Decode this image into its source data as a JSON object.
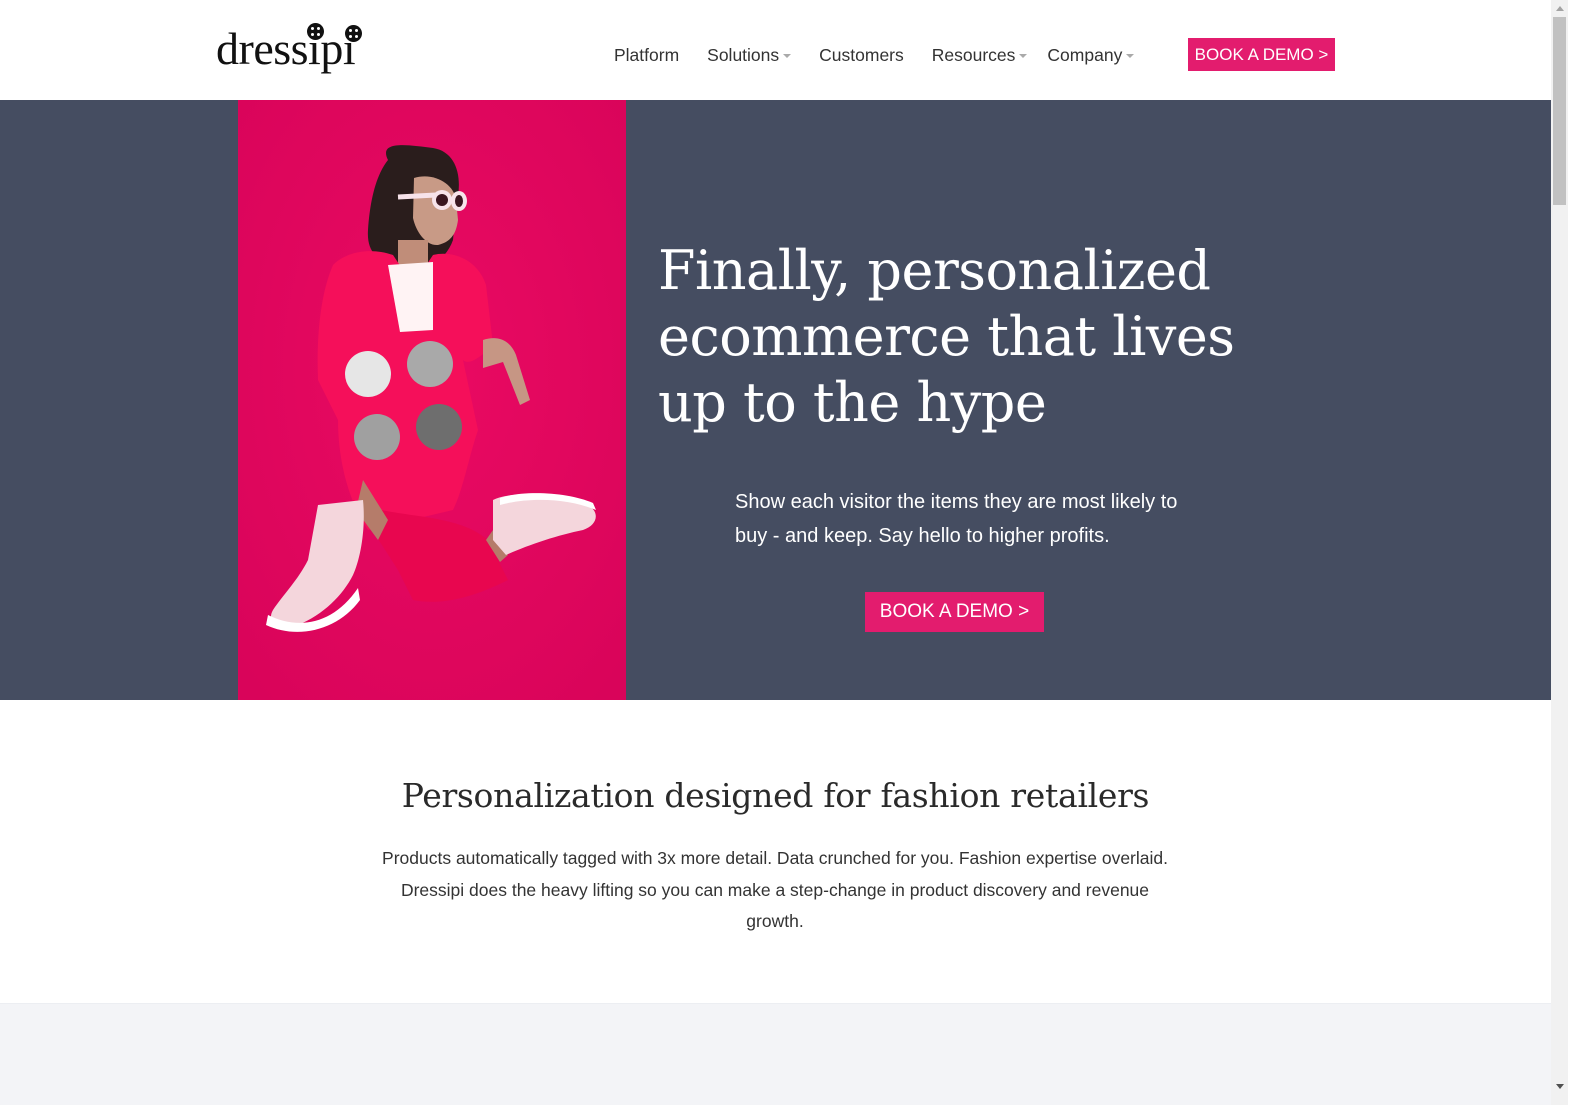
{
  "brand": {
    "logo_text": "dressipi",
    "accent_color": "#e31c6e",
    "hero_bg_color": "#454d61",
    "image_bg_color": "#e1065c"
  },
  "nav": {
    "items": [
      {
        "label": "Platform",
        "has_dropdown": false
      },
      {
        "label": "Solutions",
        "has_dropdown": true
      },
      {
        "label": "Customers",
        "has_dropdown": false
      },
      {
        "label": "Resources",
        "has_dropdown": true
      },
      {
        "label": "Company",
        "has_dropdown": true
      }
    ],
    "cta_label": "BOOK A DEMO >"
  },
  "hero": {
    "title": "Finally, personalized ecommerce that lives up to the hype",
    "subtitle": "Show each visitor the items they are most likely to buy - and keep. Say hello to higher profits.",
    "cta_label": "BOOK A DEMO >",
    "image_alt": "Model in pink suit, white sunglasses and white boots on pink background",
    "swatch_colors": [
      "#e6e6e6",
      "#a9a9a9",
      "#a0a0a0",
      "#6e6e6e"
    ]
  },
  "intro": {
    "title": "Personalization designed for fashion retailers",
    "body": "Products automatically tagged with 3x more detail. Data crunched for you. Fashion expertise overlaid. Dressipi does the heavy lifting so you can make a step-change in product discovery and revenue growth."
  }
}
